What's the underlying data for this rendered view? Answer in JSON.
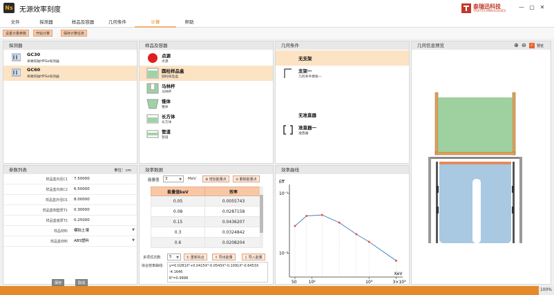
{
  "app": {
    "title": "无源效率刻度",
    "logo_text": "Ns"
  },
  "brand": {
    "name_cn": "泰瑞迅科技",
    "name_en": "TRXTECHNOLOGIES"
  },
  "window_controls": {
    "minimize": "—",
    "maximize": "▢",
    "close": "✕"
  },
  "menu": [
    "文件",
    "探测器",
    "样品及容器",
    "几何条件",
    "计算",
    "帮助"
  ],
  "menu_active_index": 4,
  "toolbar": [
    "设置计量参数",
    "开始计算",
    "保存计算任务"
  ],
  "detector": {
    "header": "探测器",
    "items": [
      {
        "name": "GC30",
        "desc": "单端同轴HPGe探测器",
        "selected": false
      },
      {
        "name": "GC60",
        "desc": "单端同轴HPGe探测器",
        "selected": true
      }
    ]
  },
  "samples": {
    "header": "样品及容器",
    "items": [
      {
        "name": "点源",
        "desc": "点源",
        "icon": "red-circle-icon",
        "selected": false
      },
      {
        "name": "圆柱样品盒",
        "desc": "圆柱样品盒",
        "icon": "cylinder-box-icon",
        "selected": true
      },
      {
        "name": "马林杯",
        "desc": "马林杯",
        "icon": "marinelli-icon",
        "selected": false
      },
      {
        "name": "锥体",
        "desc": "锥体",
        "icon": "cone-icon",
        "selected": false
      },
      {
        "name": "长方体",
        "desc": "长方体",
        "icon": "cuboid-icon",
        "selected": false
      },
      {
        "name": "管道",
        "desc": "管道",
        "icon": "pipe-icon",
        "selected": false
      }
    ]
  },
  "geometry": {
    "header": "几何条件",
    "items": [
      {
        "name": "无支架",
        "desc": "",
        "selected": true
      },
      {
        "name": "支架一",
        "desc": "几何条件模板一",
        "selected": false
      },
      {
        "name": "无准直器",
        "desc": "",
        "selected": false
      },
      {
        "name": "准直器一",
        "desc": "准直器",
        "selected": false
      }
    ]
  },
  "preview": {
    "header": "几何信息预览",
    "checkbox_label": "预览"
  },
  "params": {
    "header": "参数列表",
    "unit": "单位：cm",
    "rows": [
      {
        "label": "样品盒内径C1",
        "value": "7.50000",
        "dropdown": false
      },
      {
        "label": "样品盒内高C2",
        "value": "6.50000",
        "dropdown": false
      },
      {
        "label": "样品盒外径D1",
        "value": "8.00000",
        "dropdown": false
      },
      {
        "label": "样品盒侧壁厚T1",
        "value": "0.30000",
        "dropdown": false
      },
      {
        "label": "样品盒底厚T2",
        "value": "0.25000",
        "dropdown": false
      },
      {
        "label": "样品材料",
        "value": "模拟土壤",
        "dropdown": true
      },
      {
        "label": "样品盒材料",
        "value": "ABS塑料",
        "dropdown": true
      }
    ],
    "save": "保存",
    "cancel": "取消"
  },
  "efficiency": {
    "header": "效率数据",
    "energy_label": "能量值",
    "energy_count": "3",
    "energy_unit": "MeV",
    "add_btn": "增加能量点",
    "del_btn": "删除能量点",
    "columns": [
      "能量值keV",
      "效率"
    ],
    "rows": [
      [
        "0.05",
        "0.0055743"
      ],
      [
        "0.08",
        "0.0287158"
      ],
      [
        "0.15",
        "0.0436207"
      ],
      [
        "0.3",
        "0.0324842"
      ],
      [
        "0.6",
        "0.0208204"
      ]
    ],
    "poly_label": "多项式次数:",
    "poly_value": "5",
    "refit_btn": "重新拟合",
    "export_btn": "导出能量",
    "import_btn": "导入能量",
    "formula_label": "拟合效率曲线:",
    "formula": "y=0.0281X⁵+0.0415X⁴-0.0543X³-0.1091X²-0.6453X",
    "formula2": "-4.1646",
    "r2": "R²=0.9998"
  },
  "chart_data": {
    "type": "line",
    "title": "效率曲线",
    "ylabel": "Eff",
    "xlabel": "KeV",
    "x_scale": "log",
    "y_scale": "log",
    "x_tick_labels": [
      "50",
      "10²",
      "10³",
      "3×10³"
    ],
    "y_tick_labels": [
      "10⁻¹",
      "10⁻²"
    ],
    "x_ticks": [
      50,
      100,
      1000,
      3000
    ],
    "y_ticks": [
      0.1,
      0.01
    ],
    "xlim": [
      40,
      3500
    ],
    "ylim": [
      0.004,
      0.12
    ],
    "series": [
      {
        "points": [
          [
            50,
            0.0285
          ],
          [
            80,
            0.042
          ],
          [
            150,
            0.0436
          ],
          [
            300,
            0.0325
          ],
          [
            600,
            0.0208
          ],
          [
            1000,
            0.0155
          ],
          [
            3000,
            0.0075
          ]
        ],
        "color": "#4a7fbf",
        "marker_color": "#e05a3a"
      }
    ]
  },
  "progress": {
    "value": 100,
    "label": "100%"
  },
  "colors": {
    "accent": "#e48a2a",
    "selection": "#fbe3c4",
    "header": "#e8e8e8"
  }
}
